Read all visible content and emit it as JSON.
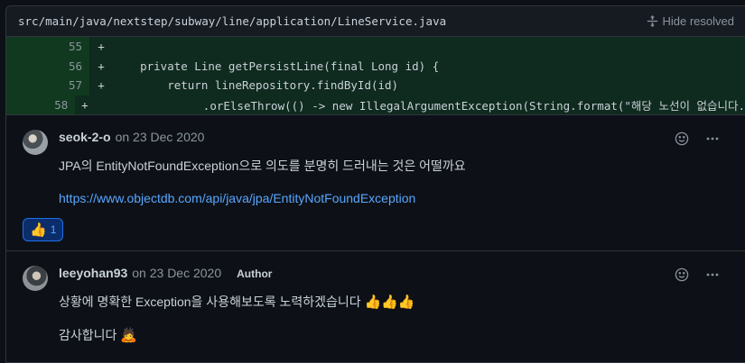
{
  "file": {
    "path": "src/main/java/nextstep/subway/line/application/LineService.java",
    "hide_resolved": "Hide resolved"
  },
  "code_lines": [
    {
      "num": "55",
      "sign": "+",
      "code": ""
    },
    {
      "num": "56",
      "sign": "+",
      "code": "    private Line getPersistLine(final Long id) {"
    },
    {
      "num": "57",
      "sign": "+",
      "code": "        return lineRepository.findById(id)"
    },
    {
      "num": "58",
      "sign": "+",
      "code": "                .orElseThrow(() -> new IllegalArgumentException(String.format(\"해당 노선이 없습니다."
    }
  ],
  "comments": [
    {
      "author": "seok-2-o",
      "date": "on 23 Dec 2020",
      "body": "JPA의 EntityNotFoundException으로 의도를 분명히 드러내는 것은 어떨까요",
      "link": "https://www.objectdb.com/api/java/jpa/EntityNotFoundException",
      "reaction_count": "1"
    },
    {
      "author": "leeyohan93",
      "date": "on 23 Dec 2020",
      "badge": "Author",
      "body": "상황에 명확한 Exception을 사용해보도록 노력하겠습니다",
      "body_emoji": "👍👍👍",
      "body2": "감사합니다",
      "body2_emoji": "🙇"
    }
  ],
  "icons": {
    "unfold": "unfold-icon",
    "smiley": "smiley-icon",
    "kebab": "kebab-horizontal-icon",
    "thumbs_up": "thumbs-up-icon"
  },
  "colors": {
    "background": "#0d1117",
    "added_line": "#0f2a1e",
    "link": "#58a6ff"
  }
}
